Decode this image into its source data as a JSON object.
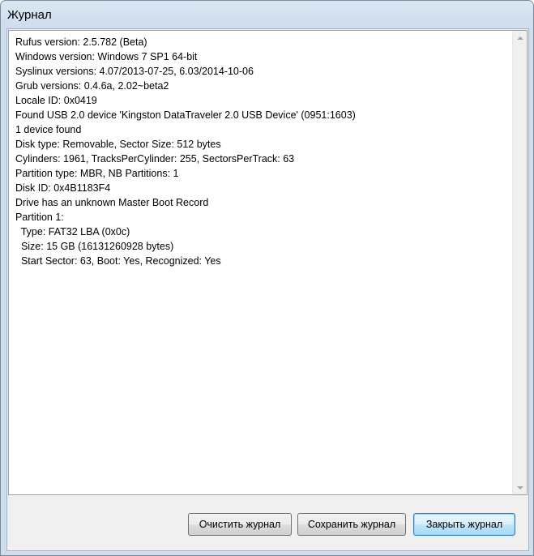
{
  "window": {
    "title": "Журнал"
  },
  "log": {
    "lines": [
      "Rufus version: 2.5.782 (Beta)",
      "Windows version: Windows 7 SP1 64-bit",
      "Syslinux versions: 4.07/2013-07-25, 6.03/2014-10-06",
      "Grub versions: 0.4.6a, 2.02~beta2",
      "Locale ID: 0x0419",
      "Found USB 2.0 device 'Kingston DataTraveler 2.0 USB Device' (0951:1603)",
      "1 device found",
      "Disk type: Removable, Sector Size: 512 bytes",
      "Cylinders: 1961, TracksPerCylinder: 255, SectorsPerTrack: 63",
      "Partition type: MBR, NB Partitions: 1",
      "Disk ID: 0x4B1183F4",
      "Drive has an unknown Master Boot Record",
      "Partition 1:",
      "  Type: FAT32 LBA (0x0c)",
      "  Size: 15 GB (16131260928 bytes)",
      "  Start Sector: 63, Boot: Yes, Recognized: Yes"
    ]
  },
  "buttons": {
    "clear_label": "Очистить журнал",
    "save_label": "Сохранить журнал",
    "close_label": "Закрыть журнал"
  },
  "icons": {
    "scroll_up": "scroll-up-arrow-icon",
    "scroll_down": "scroll-down-arrow-icon"
  },
  "colors": {
    "frame": "#cfdded",
    "default_button_border": "#3c7fb1"
  }
}
